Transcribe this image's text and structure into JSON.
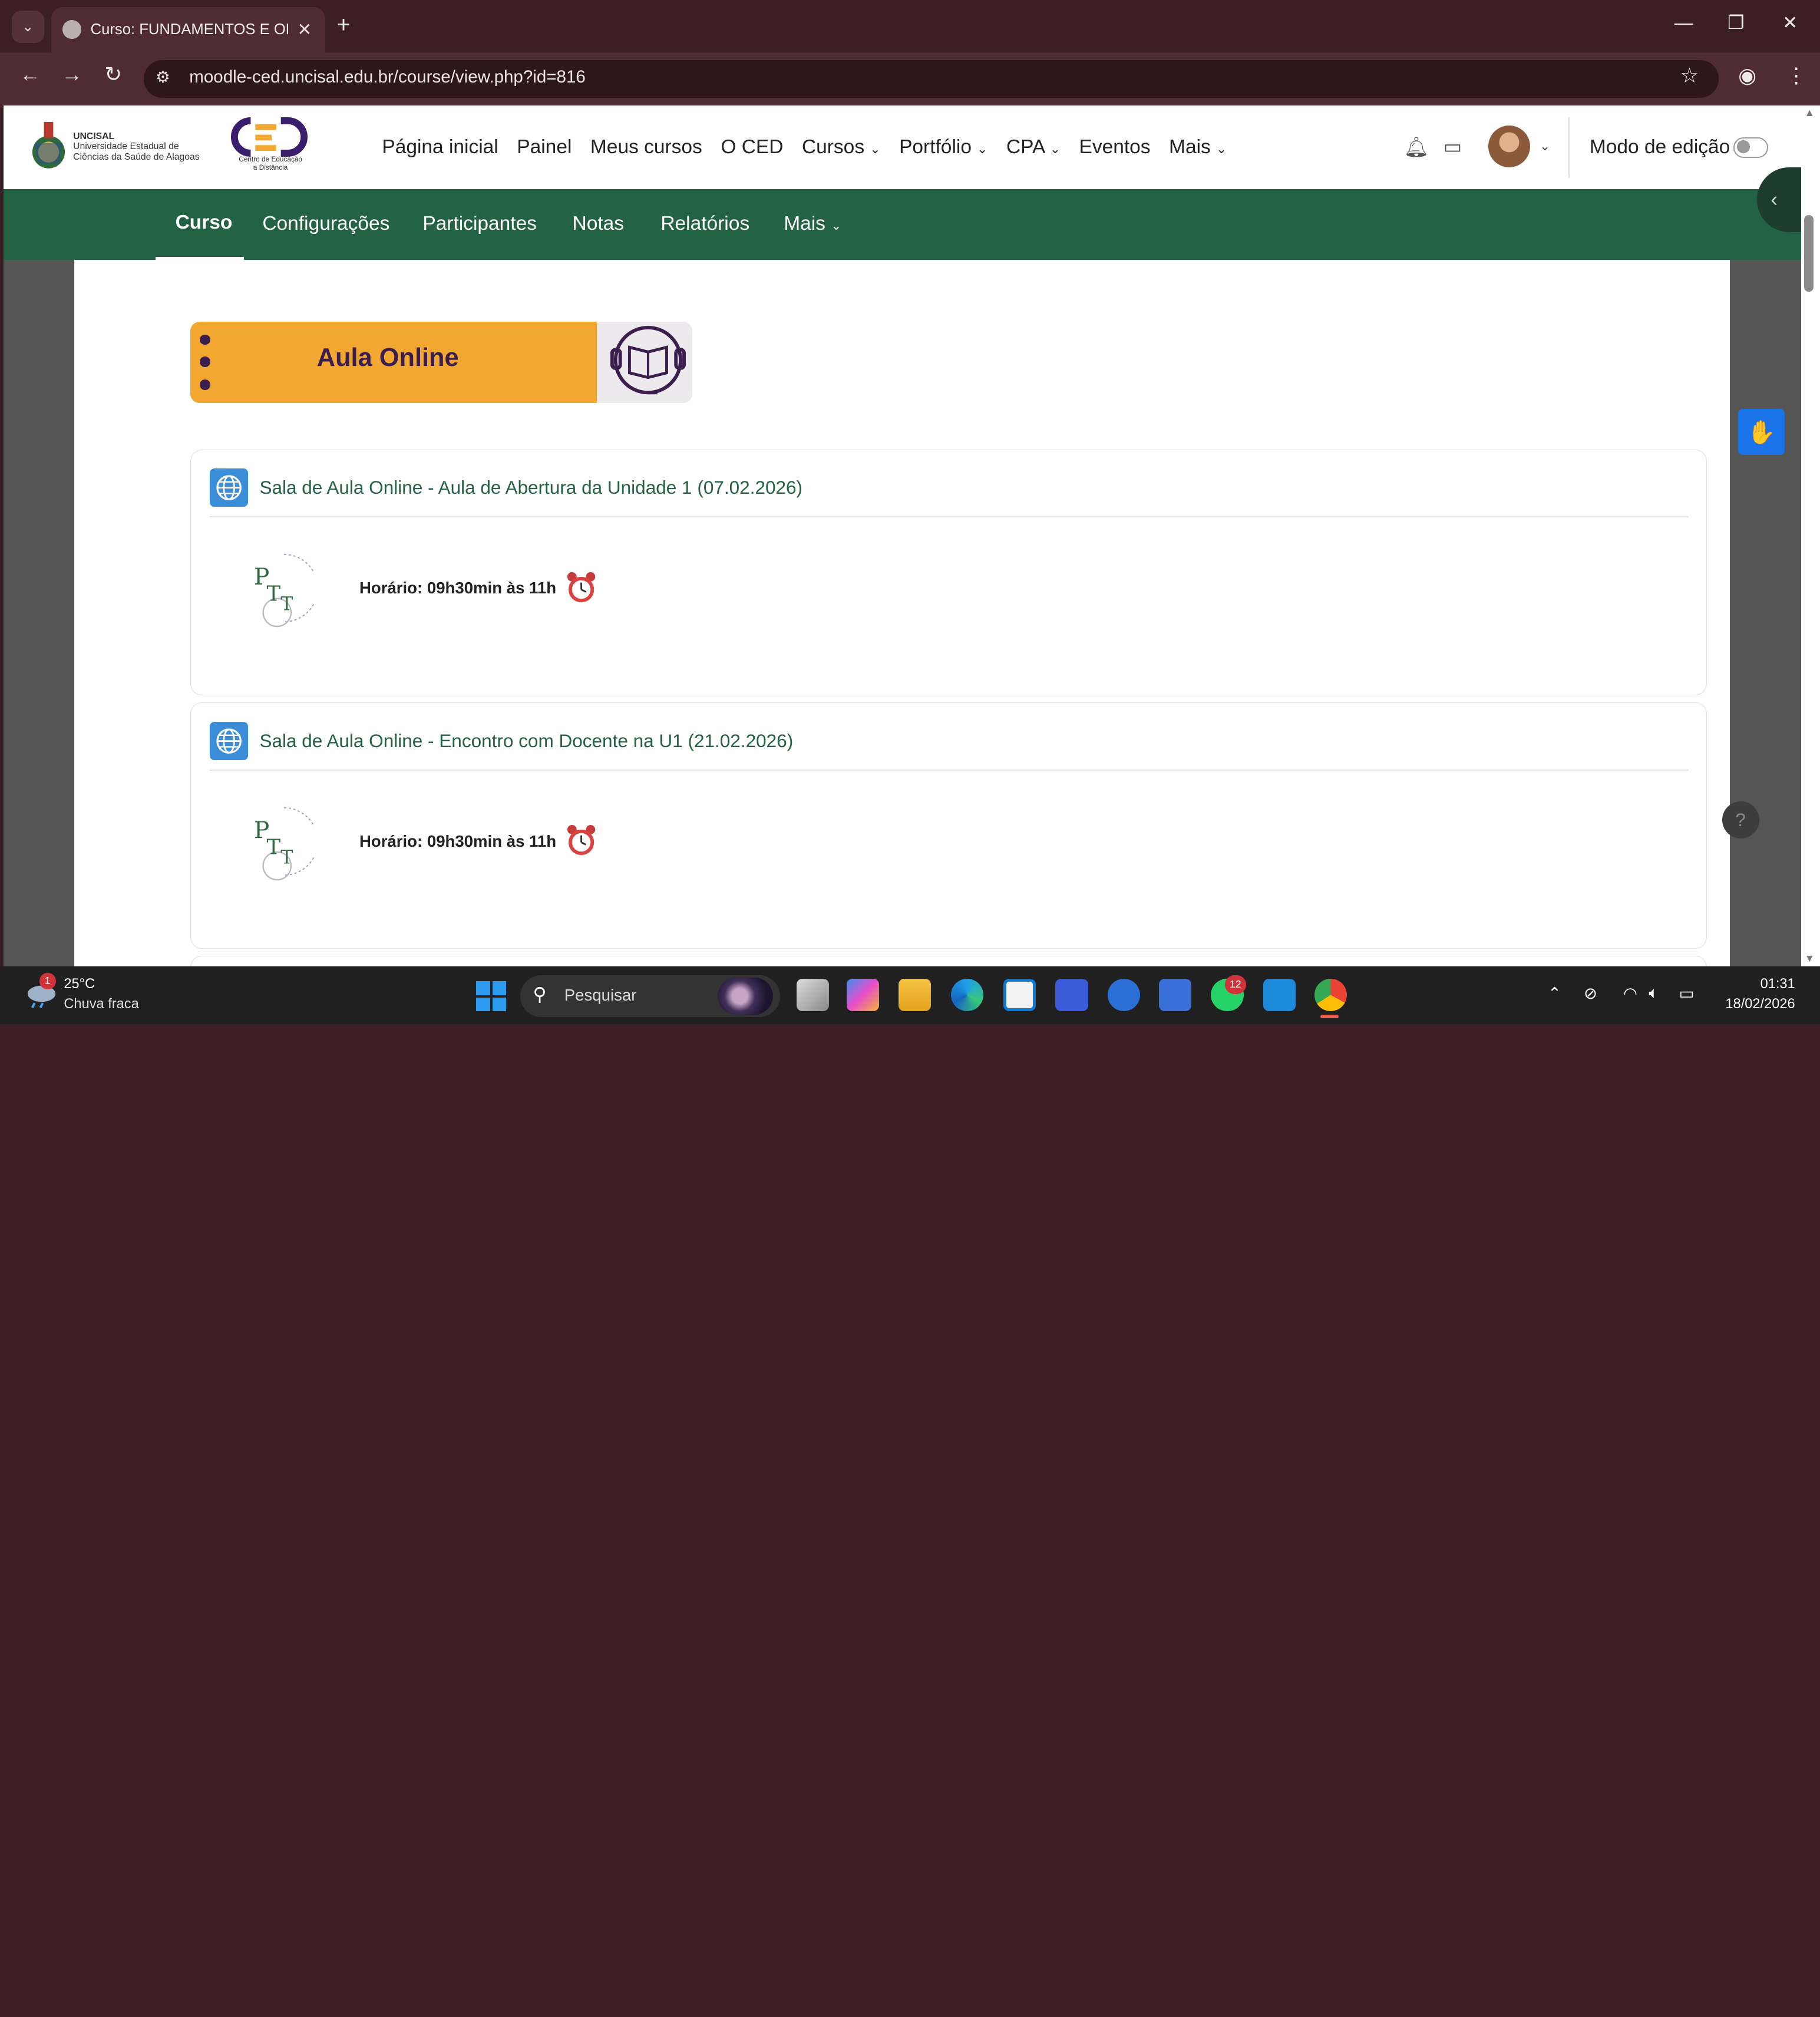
{
  "browser": {
    "tab_title": "Curso: FUNDAMENTOS E ORIEN",
    "url": "moodle-ced.uncisal.edu.br/course/view.php?id=816"
  },
  "header": {
    "logo_name": "UNCISAL",
    "logo_sub1": "Universidade Estadual de",
    "logo_sub2": "Ciências da Saúde de Alagoas",
    "ced_sub1": "Centro de Educação",
    "ced_sub2": "a Distância",
    "nav": [
      "Página inicial",
      "Painel",
      "Meus cursos",
      "O CED",
      "Cursos",
      "Portfólio",
      "CPA",
      "Eventos",
      "Mais"
    ],
    "edit_mode_label": "Modo de edição"
  },
  "course_nav": {
    "items": [
      "Curso",
      "Configurações",
      "Participantes",
      "Notas",
      "Relatórios",
      "Mais"
    ],
    "active": "Curso"
  },
  "banner": {
    "title": "Aula Online"
  },
  "activities": [
    {
      "title": "Sala de Aula Online - Aula de Abertura da Unidade 1 (07.02.2026)",
      "schedule": "Horário: 09h30min às 11h"
    },
    {
      "title": "Sala de Aula Online - Encontro com Docente na U1 (21.02.2026)",
      "schedule": "Horário: 09h30min às 11h"
    }
  ],
  "taskbar": {
    "temperature": "25°C",
    "condition": "Chuva fraca",
    "weather_badge": "1",
    "search_placeholder": "Pesquisar",
    "whatsapp_badge": "12",
    "time": "01:31",
    "date": "18/02/2026"
  },
  "colors": {
    "course_nav": "#236243",
    "banner_orange": "#f2a830",
    "link_green": "#236243"
  }
}
